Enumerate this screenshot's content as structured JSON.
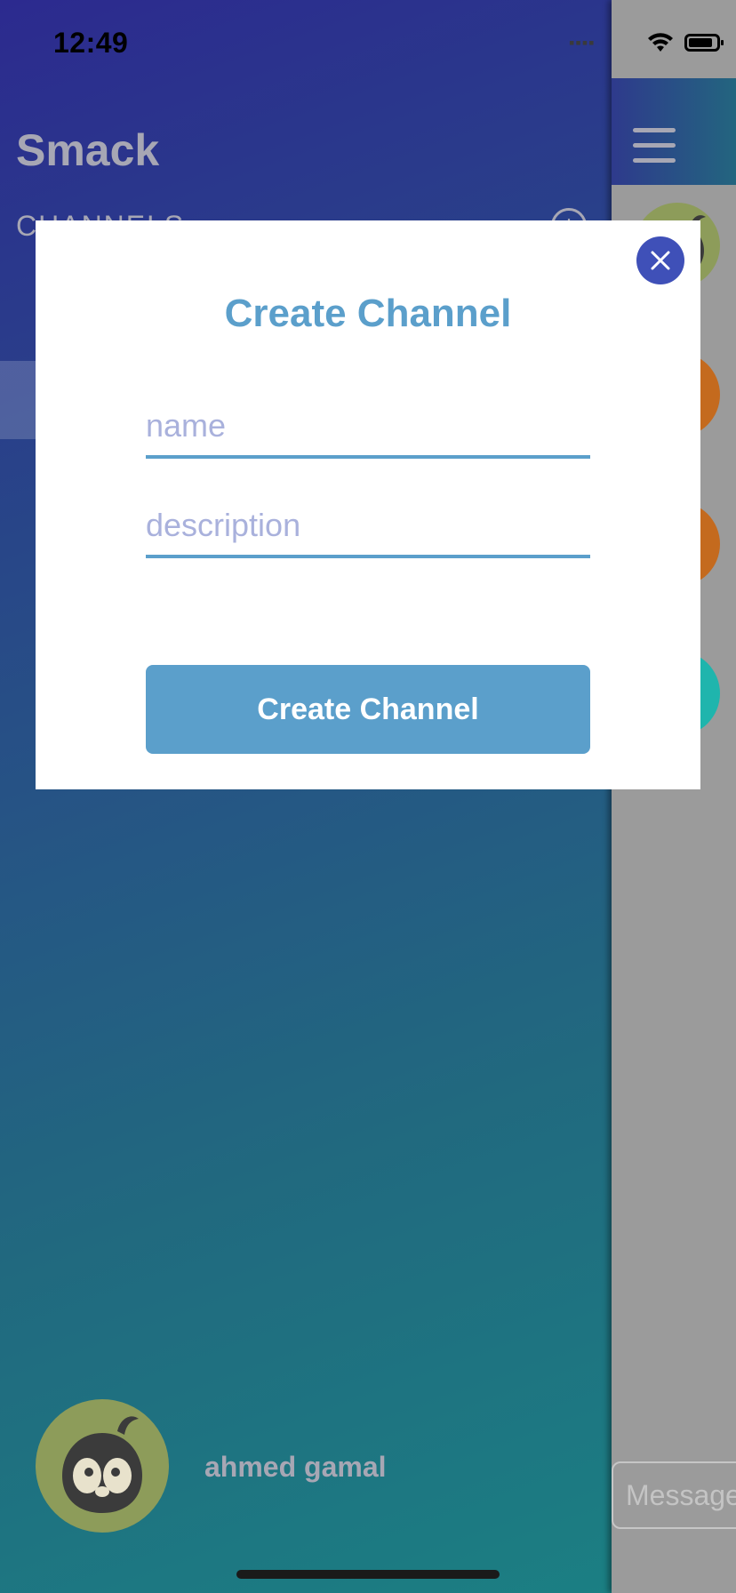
{
  "status_bar": {
    "time": "12:49"
  },
  "drawer": {
    "app_title": "Smack",
    "channels_label": "CHANNELS",
    "add_icon_glyph": "+",
    "user": {
      "name": "ahmed gamal",
      "avatar_icon": "penguin-avatar-icon"
    }
  },
  "chat": {
    "message_placeholder": "Message",
    "avatar_colors": [
      "#8d9c5a",
      "#c46a1e",
      "#c46a1e",
      "#1fb5ad"
    ]
  },
  "modal": {
    "title": "Create Channel",
    "name_placeholder": "name",
    "description_placeholder": "description",
    "submit_label": "Create Channel"
  },
  "colors": {
    "accent": "#5b9fcb",
    "close_button": "#3f50b8",
    "placeholder": "#a9b1dc"
  }
}
